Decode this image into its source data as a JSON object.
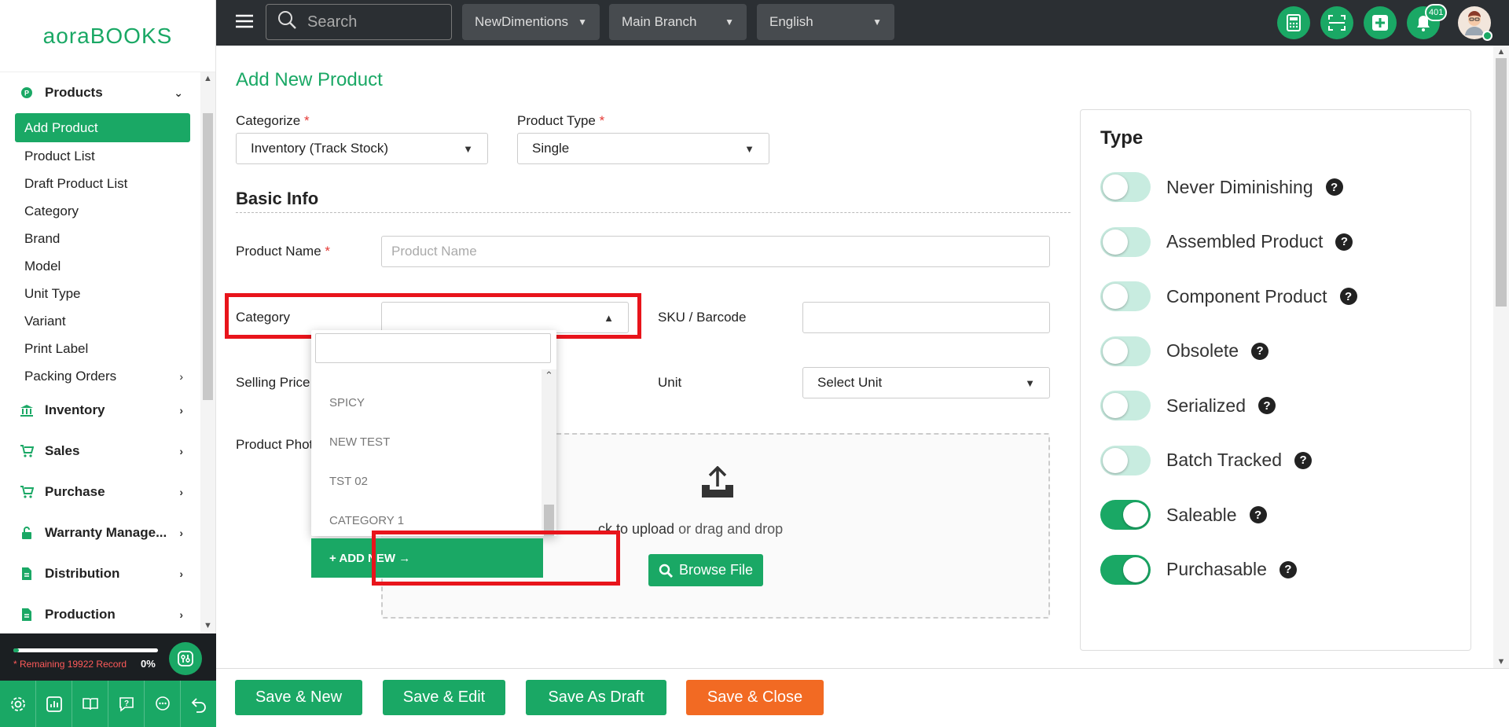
{
  "app": {
    "logo_text": "aoraBOOKS"
  },
  "sidebar": {
    "products_group": {
      "label": "Products",
      "icon": "products-icon"
    },
    "product_items": [
      {
        "label": "Add Product",
        "active": true
      },
      {
        "label": "Product List"
      },
      {
        "label": "Draft Product List"
      },
      {
        "label": "Category"
      },
      {
        "label": "Brand"
      },
      {
        "label": "Model"
      },
      {
        "label": "Unit Type"
      },
      {
        "label": "Variant"
      },
      {
        "label": "Print Label"
      },
      {
        "label": "Packing Orders"
      }
    ],
    "groups": [
      {
        "label": "Inventory",
        "icon": "inventory-icon"
      },
      {
        "label": "Sales",
        "icon": "cart-icon"
      },
      {
        "label": "Purchase",
        "icon": "cart-icon"
      },
      {
        "label": "Warranty Manage...",
        "icon": "lock-icon"
      },
      {
        "label": "Distribution",
        "icon": "document-icon"
      },
      {
        "label": "Production",
        "icon": "document-icon"
      }
    ],
    "record": {
      "text": "* Remaining 19922 Record",
      "percent": "0%",
      "fill_fraction": 0.04
    }
  },
  "topbar": {
    "search_placeholder": "Search",
    "company": "NewDimentions",
    "branch": "Main Branch",
    "language": "English",
    "notification_count": "401"
  },
  "page": {
    "title": "Add New Product",
    "categorize": {
      "label": "Categorize",
      "value": "Inventory (Track Stock)"
    },
    "product_type": {
      "label": "Product Type",
      "value": "Single"
    },
    "section_title": "Basic Info",
    "product_name": {
      "label": "Product Name",
      "placeholder": "Product Name"
    },
    "category": {
      "label": "Category"
    },
    "sku": {
      "label": "SKU / Barcode"
    },
    "selling_price": {
      "label": "Selling Price"
    },
    "unit": {
      "label": "Unit",
      "value": "Select Unit"
    },
    "product_photo": {
      "label": "Product Photo"
    },
    "upload": {
      "click_text": "ck to upload",
      "drag_text": " or drag and drop",
      "browse_label": "Browse File"
    },
    "required_mark": "*"
  },
  "category_dropdown": {
    "options": [
      "SPICY",
      "NEW TEST",
      "TST 02",
      "CATEGORY 1"
    ],
    "add_new_label": "+ ADD NEW →"
  },
  "type_panel": {
    "title": "Type",
    "toggles": [
      {
        "label": "Never Diminishing",
        "on": false
      },
      {
        "label": "Assembled Product",
        "on": false
      },
      {
        "label": "Component Product",
        "on": false
      },
      {
        "label": "Obsolete",
        "on": false
      },
      {
        "label": "Serialized",
        "on": false
      },
      {
        "label": "Batch Tracked",
        "on": false
      },
      {
        "label": "Saleable",
        "on": true
      },
      {
        "label": "Purchasable",
        "on": true
      }
    ]
  },
  "footer": {
    "save_new": "Save & New",
    "save_edit": "Save & Edit",
    "save_draft": "Save As Draft",
    "save_close": "Save & Close"
  },
  "colors": {
    "accent": "#1aa865",
    "orange": "#f26a23",
    "highlight": "#e8141b"
  }
}
